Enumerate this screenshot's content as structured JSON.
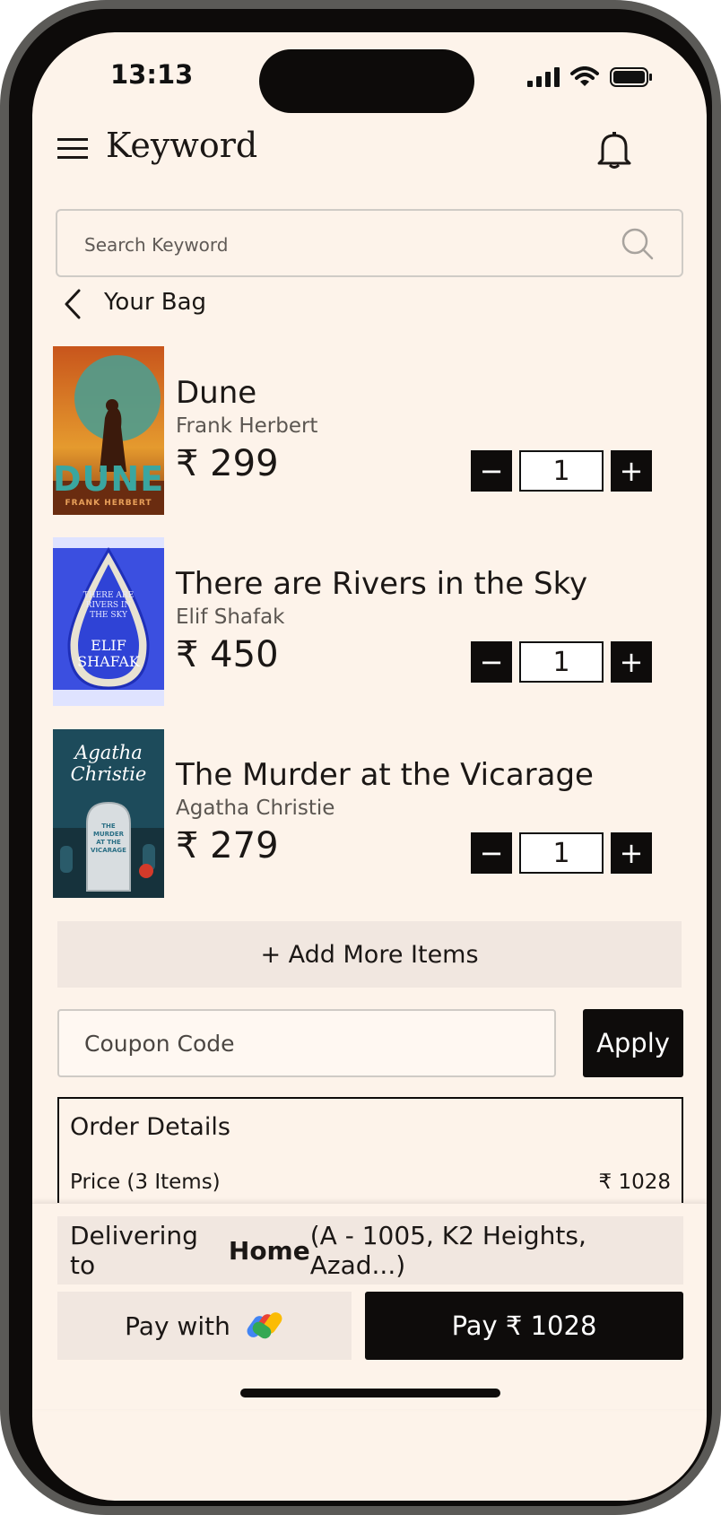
{
  "status": {
    "time": "13:13"
  },
  "header": {
    "title": "Keyword",
    "menu_icon": "hamburger-menu-icon",
    "bell_icon": "bell-icon"
  },
  "search": {
    "placeholder": "Search Keyword",
    "icon": "search-icon"
  },
  "bag": {
    "title": "Your Bag",
    "back_icon": "chevron-left-icon"
  },
  "items": [
    {
      "title": "Dune",
      "author": "Frank Herbert",
      "price": "₹ 299",
      "qty": "1",
      "cover_text": "DUNE",
      "cover_author": "FRANK HERBERT"
    },
    {
      "title": "There are Rivers in the Sky",
      "author": "Elif Shafak",
      "price": "₹ 450",
      "qty": "1",
      "cover_text": "ELIF SHAFAK",
      "cover_sub": "THERE ARE RIVERS IN THE SKY"
    },
    {
      "title": "The Murder at the Vicarage",
      "author": "Agatha Christie",
      "price": "₹ 279",
      "qty": "1",
      "cover_text": "Agatha Christie",
      "cover_sub": "THE MURDER AT THE VICARAGE"
    }
  ],
  "qty_controls": {
    "minus": "−",
    "plus": "+"
  },
  "add_more": "+ Add More Items",
  "coupon": {
    "placeholder": "Coupon Code",
    "apply": "Apply"
  },
  "order": {
    "title": "Order Details",
    "price_label": "Price (3 Items)",
    "price_value": "₹ 1028"
  },
  "delivery": {
    "prefix": "Delivering to ",
    "place": "Home",
    "address": " (A - 1005, K2 Heights, Azad...)"
  },
  "pay": {
    "with_label": "Pay with",
    "gpay_icon": "google-pay-icon",
    "pay_label": "Pay ₹ 1028"
  },
  "colors": {
    "background": "#fdf3ea",
    "dark": "#0e0c0b",
    "muted_panel": "#f1e7e0"
  }
}
